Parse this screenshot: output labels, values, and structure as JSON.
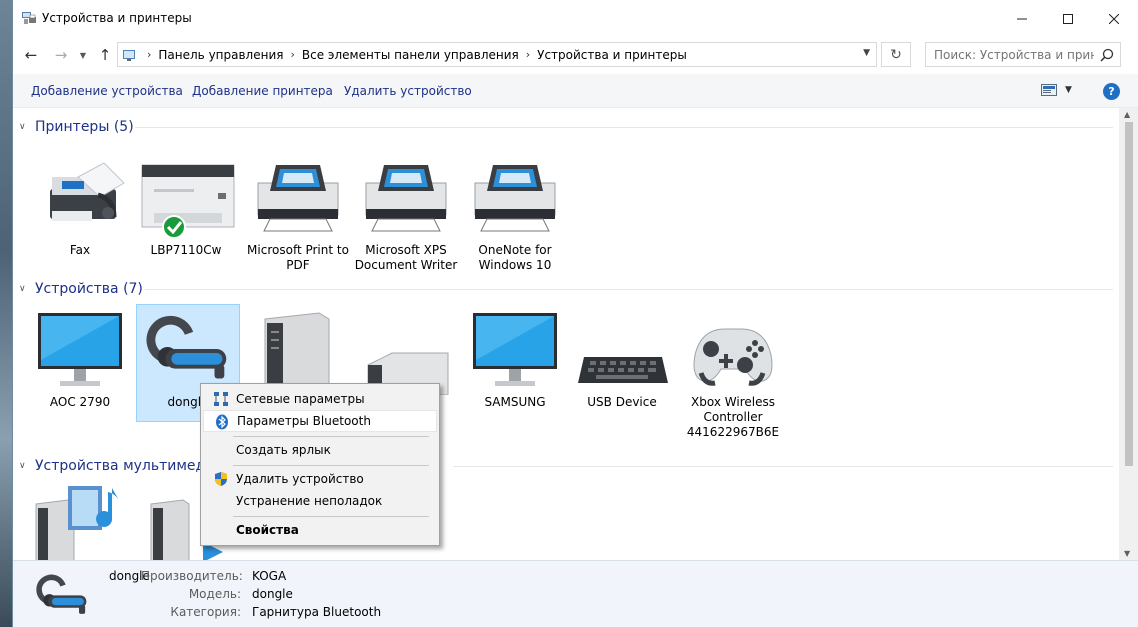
{
  "window": {
    "title": "Устройства и принтеры"
  },
  "address": {
    "crumbs": [
      "Панель управления",
      "Все элементы панели управления",
      "Устройства и принтеры"
    ]
  },
  "search": {
    "placeholder": "Поиск: Устройства и принте..."
  },
  "commands": {
    "add_device": "Добавление устройства",
    "add_printer": "Добавление принтера",
    "remove_device": "Удалить устройство",
    "help": "?"
  },
  "groups": {
    "printers": {
      "title": "Принтеры (5)",
      "items": [
        {
          "label": "Fax",
          "icon": "fax-icon"
        },
        {
          "label": "LBP7110Cw",
          "icon": "laser-printer-icon",
          "default": true
        },
        {
          "label": "Microsoft Print to PDF",
          "icon": "printer-icon"
        },
        {
          "label": "Microsoft XPS Document Writer",
          "icon": "printer-icon"
        },
        {
          "label": "OneNote for Windows 10",
          "icon": "printer-icon"
        }
      ]
    },
    "devices": {
      "title": "Устройства (7)",
      "items": [
        {
          "label": "AOC 2790",
          "icon": "monitor-icon"
        },
        {
          "label": "dongle",
          "icon": "headset-icon",
          "selected": true
        },
        {
          "label": "",
          "icon": "computer-tower-icon"
        },
        {
          "label": "",
          "icon": "drive-icon"
        },
        {
          "label": "SAMSUNG",
          "icon": "monitor-icon"
        },
        {
          "label": "USB Device",
          "icon": "keyboard-icon"
        },
        {
          "label": "Xbox Wireless Controller 441622967B6E",
          "icon": "gamepad-icon"
        }
      ]
    },
    "multimedia": {
      "title": "Устройства мультимеди"
    }
  },
  "context_menu": {
    "items": [
      {
        "label": "Сетевые параметры",
        "icon": "network-icon"
      },
      {
        "label": "Параметры Bluetooth",
        "icon": "bluetooth-icon",
        "hover": true
      },
      {
        "label": "Создать ярлык"
      },
      {
        "label": "Удалить устройство",
        "icon": "uac-shield-icon"
      },
      {
        "label": "Устранение неполадок"
      },
      {
        "label": "Свойства",
        "bold": true
      }
    ]
  },
  "details": {
    "name": "dongle",
    "manufacturer_key": "Производитель:",
    "manufacturer_val": "KOGA",
    "model_key": "Модель:",
    "model_val": "dongle",
    "category_key": "Категория:",
    "category_val": "Гарнитура Bluetooth"
  },
  "colors": {
    "accent": "#1e3287",
    "selection": "#cce8ff",
    "details_bg": "#f1f5fb"
  }
}
